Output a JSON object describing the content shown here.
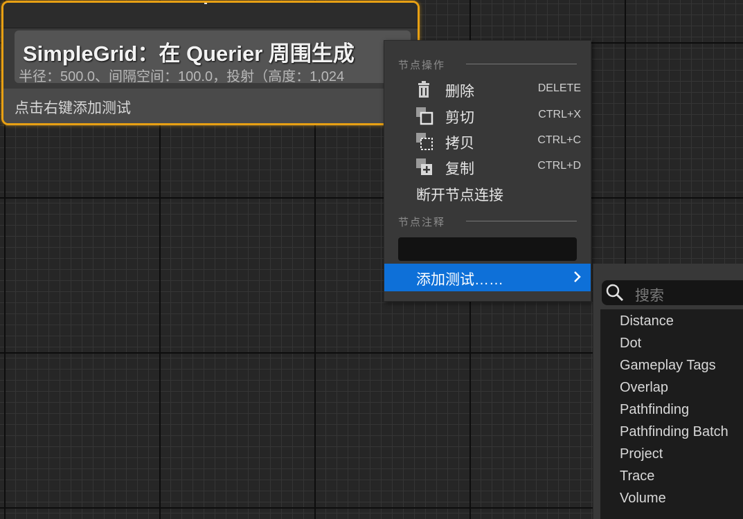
{
  "node": {
    "title": "SimpleGrid：在 Querier 周围生成",
    "subtitle": "半径：500.0、间隔空间：100.0，投射（高度：1,024",
    "hint": "点击右键添加测试"
  },
  "context_menu": {
    "section_node_actions": "节点操作",
    "items": [
      {
        "label": "删除",
        "shortcut": "DELETE",
        "icon": "trash-icon"
      },
      {
        "label": "剪切",
        "shortcut": "CTRL+X",
        "icon": "cut-icon"
      },
      {
        "label": "拷贝",
        "shortcut": "CTRL+C",
        "icon": "copy-icon"
      },
      {
        "label": "复制",
        "shortcut": "CTRL+D",
        "icon": "duplicate-icon"
      },
      {
        "label": "断开节点连接",
        "shortcut": "",
        "icon": ""
      }
    ],
    "section_node_comment": "节点注释",
    "comment_value": "",
    "add_test_label": "添加测试……"
  },
  "submenu": {
    "search_placeholder": "搜索",
    "items": [
      "Distance",
      "Dot",
      "Gameplay Tags",
      "Overlap",
      "Pathfinding",
      "Pathfinding Batch",
      "Project",
      "Trace",
      "Volume"
    ]
  },
  "colors": {
    "node_border": "#e8a013",
    "highlight": "#0e70d8"
  }
}
